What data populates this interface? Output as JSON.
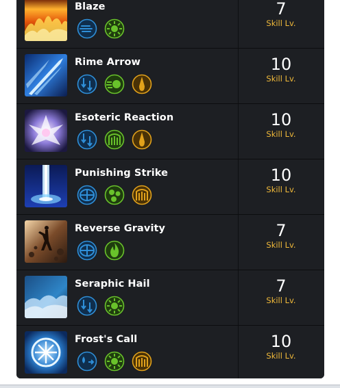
{
  "skills": [
    {
      "name": "Blaze",
      "level": "7",
      "level_label": "Skill Lv.",
      "art": "fire",
      "tripods": [
        {
          "icon": "wind-lines-icon",
          "tier": "blue"
        },
        {
          "icon": "burst-icon",
          "tier": "green"
        }
      ]
    },
    {
      "name": "Rime Arrow",
      "level": "10",
      "level_label": "Skill Lv.",
      "art": "ice-arrow",
      "tripods": [
        {
          "icon": "split-arrows-icon",
          "tier": "blue"
        },
        {
          "icon": "orb-dash-icon",
          "tier": "green"
        },
        {
          "icon": "flame-spike-icon",
          "tier": "gold"
        }
      ]
    },
    {
      "name": "Esoteric Reaction",
      "level": "10",
      "level_label": "Skill Lv.",
      "art": "crystal",
      "tripods": [
        {
          "icon": "split-arrows-icon",
          "tier": "blue"
        },
        {
          "icon": "gate-icon",
          "tier": "green"
        },
        {
          "icon": "flame-spike-icon",
          "tier": "gold"
        }
      ]
    },
    {
      "name": "Punishing Strike",
      "level": "10",
      "level_label": "Skill Lv.",
      "art": "light-pillar",
      "tripods": [
        {
          "icon": "target-icon",
          "tier": "blue"
        },
        {
          "icon": "cluster-icon",
          "tier": "green"
        },
        {
          "icon": "gate-icon",
          "tier": "gold"
        }
      ]
    },
    {
      "name": "Reverse Gravity",
      "level": "7",
      "level_label": "Skill Lv.",
      "art": "gravity",
      "tripods": [
        {
          "icon": "target-icon",
          "tier": "blue"
        },
        {
          "icon": "flame-icon",
          "tier": "green"
        }
      ]
    },
    {
      "name": "Seraphic Hail",
      "level": "7",
      "level_label": "Skill Lv.",
      "art": "hail",
      "tripods": [
        {
          "icon": "split-arrows-icon",
          "tier": "blue"
        },
        {
          "icon": "burst-icon",
          "tier": "green"
        }
      ]
    },
    {
      "name": "Frost's Call",
      "level": "10",
      "level_label": "Skill Lv.",
      "art": "frost",
      "tripods": [
        {
          "icon": "drop-arrow-icon",
          "tier": "blue"
        },
        {
          "icon": "burst-icon",
          "tier": "green"
        },
        {
          "icon": "gate-icon",
          "tier": "gold"
        }
      ]
    }
  ],
  "colors": {
    "panel": "#16171a",
    "row": "#1d1f23",
    "level_label": "#f0b93a",
    "tier_blue": "#2f8fd8",
    "tier_green": "#69c22b",
    "tier_gold": "#e2a21b"
  }
}
